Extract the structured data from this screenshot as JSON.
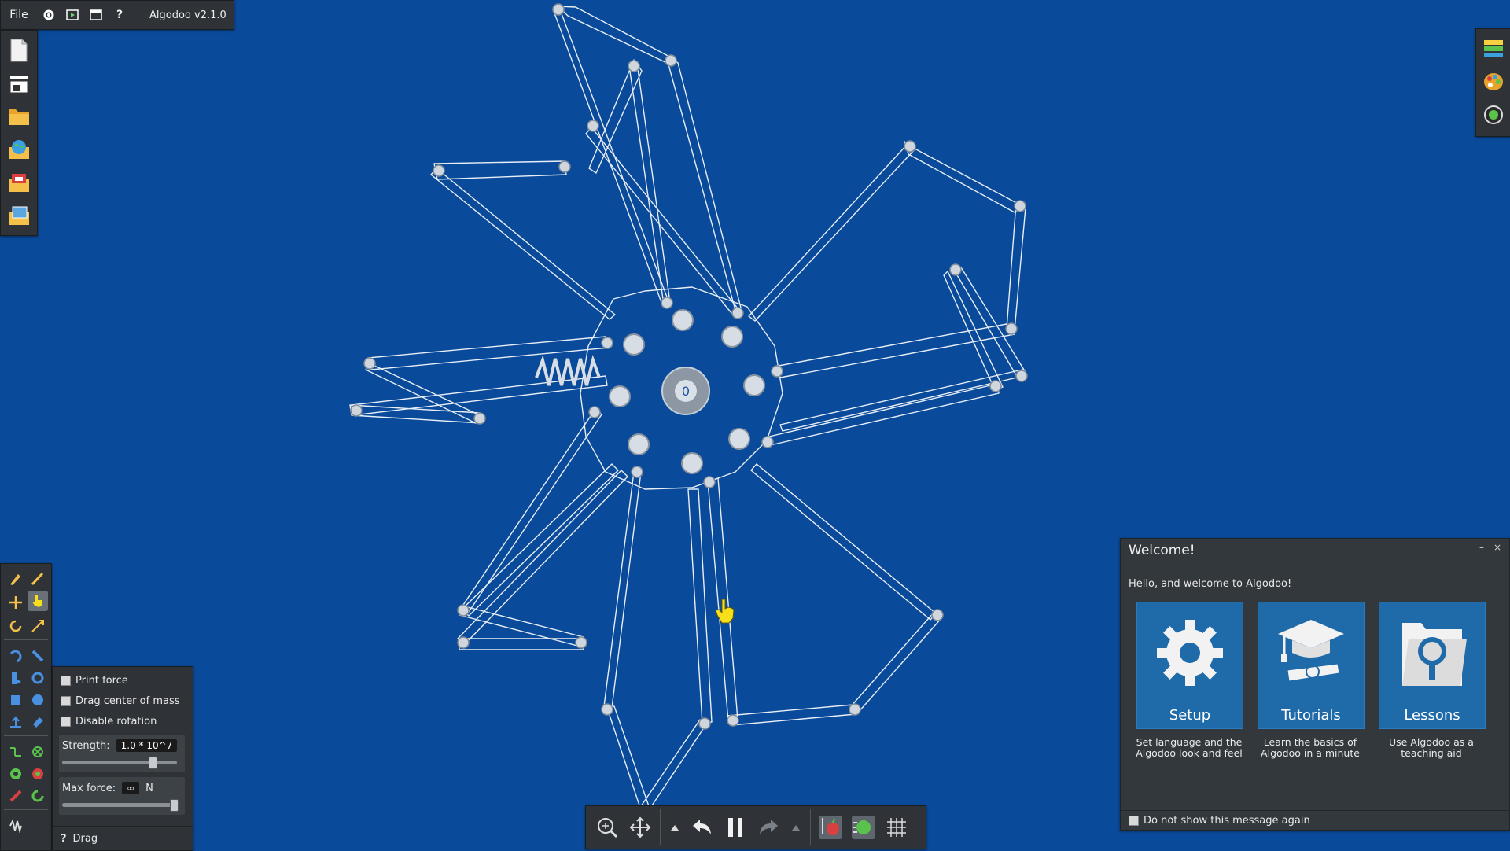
{
  "topbar": {
    "file_label": "File",
    "icons": [
      "gear-icon",
      "play-scene-icon",
      "window-icon",
      "help-icon"
    ],
    "help_label": "?",
    "version": "Algodoo v2.1.0"
  },
  "left_toolbar": {
    "items": [
      "new-scene-icon",
      "scene-layers-icon",
      "open-folder-icon",
      "algobox-globe-icon",
      "phunlets-icon",
      "scene-browser-icon"
    ]
  },
  "right_toolbar": {
    "items": [
      "background-layers-icon",
      "palette-icon",
      "scene-settings-icon"
    ]
  },
  "tools": {
    "items": [
      "sketch-tool",
      "cut-tool",
      "move-tool",
      "drag-tool",
      "rotate-tool",
      "scale-tool",
      "rope-tool",
      "knife-tool",
      "brush-tool",
      "gear-tool",
      "box-tool",
      "circle-tool",
      "plane-tool",
      "polygon-tool",
      "chain-tool",
      "fixate-tool",
      "axle-tool",
      "tracer-tool",
      "laser-tool",
      "thruster-tool",
      "spring-tool"
    ],
    "active": "drag-tool"
  },
  "drag_options": {
    "print_force": "Print force",
    "drag_center": "Drag center of mass",
    "disable_rotation": "Disable rotation",
    "strength_label": "Strength:",
    "strength_value": "1.0 * 10^7",
    "strength_level": 0.8,
    "maxforce_label": "Max force:",
    "maxforce_value": "∞",
    "maxforce_unit": "N",
    "maxforce_level": 1.0,
    "footer_help": "?",
    "footer_label": "Drag"
  },
  "bottom_toolbar": {
    "items": [
      "zoom-icon",
      "pan-icon",
      "undo-menu-icon",
      "undo-icon",
      "pause-icon",
      "redo-icon",
      "redo-menu-icon",
      "gravity-icon",
      "air-friction-icon",
      "grid-icon"
    ]
  },
  "welcome": {
    "title": "Welcome!",
    "minimize": "–",
    "close": "×",
    "hello": "Hello, and welcome to Algodoo!",
    "cards": [
      {
        "title": "Setup",
        "desc": "Set language and the Algodoo look and feel"
      },
      {
        "title": "Tutorials",
        "desc": "Learn the basics of Algodoo in a minute"
      },
      {
        "title": "Lessons",
        "desc": "Use Algodoo as a teaching aid"
      }
    ],
    "dont_show": "Do not show this message again"
  },
  "scene": {
    "hub_label": "0",
    "line_color": "#e8eef6",
    "background_color": "#0a4a9a"
  }
}
